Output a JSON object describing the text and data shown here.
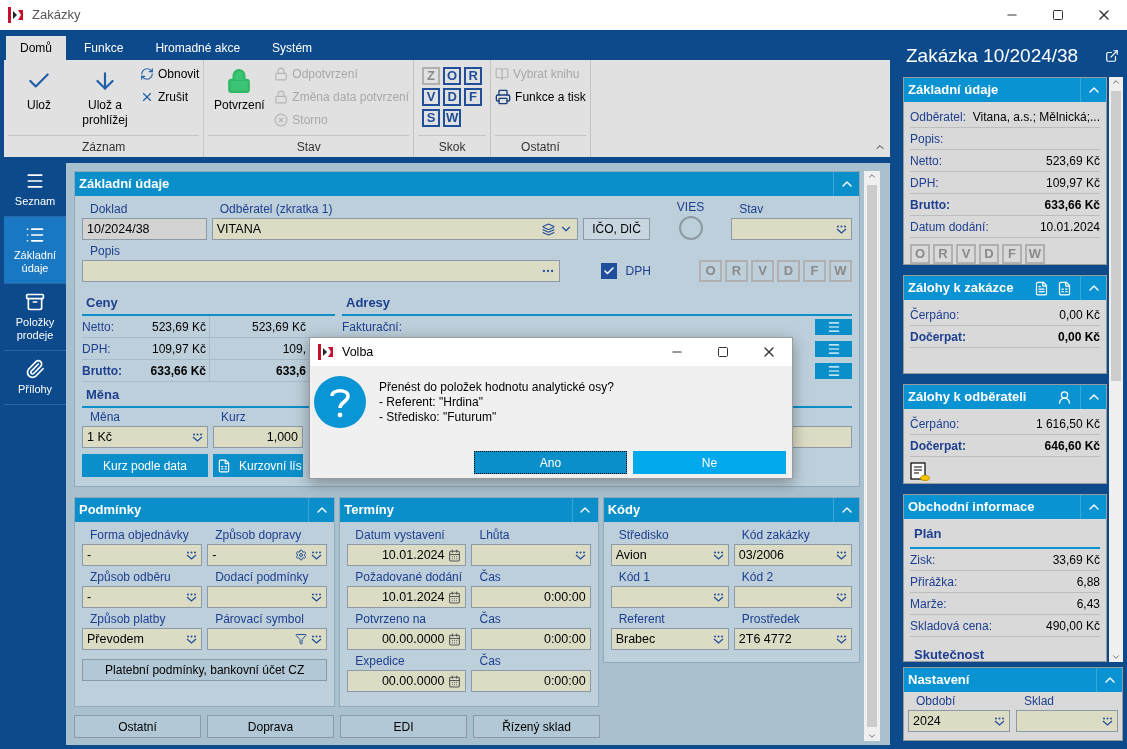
{
  "window": {
    "title": "Zakázky"
  },
  "ribbon": {
    "tabs": [
      {
        "label": "Domů",
        "selected": true
      },
      {
        "label": "Funkce",
        "selected": false
      },
      {
        "label": "Hromadné akce",
        "selected": false
      },
      {
        "label": "Systém",
        "selected": false
      }
    ],
    "groups": [
      {
        "label": "Záznam",
        "items": [
          {
            "kind": "large",
            "label": "Ulož",
            "disabled": false
          },
          {
            "kind": "large",
            "label": "Ulož a prohlížej",
            "disabled": false
          },
          {
            "kind": "small",
            "label": "Obnovit",
            "disabled": false
          },
          {
            "kind": "small",
            "label": "Zrušit",
            "disabled": false
          }
        ]
      },
      {
        "label": "Stav",
        "items": [
          {
            "kind": "large",
            "label": "Potvrzení",
            "disabled": false
          },
          {
            "kind": "small",
            "label": "Odpotvrzení",
            "disabled": true
          },
          {
            "kind": "small",
            "label": "Změna data potvrzení",
            "disabled": true
          },
          {
            "kind": "small",
            "label": "Storno",
            "disabled": true
          }
        ]
      },
      {
        "label": "Skok",
        "items": [
          {
            "kind": "letter",
            "label": "Z",
            "disabled": true
          },
          {
            "kind": "letter",
            "label": "O",
            "disabled": false
          },
          {
            "kind": "letter",
            "label": "R",
            "disabled": false
          },
          {
            "kind": "letter",
            "label": "V",
            "disabled": false
          },
          {
            "kind": "letter",
            "label": "D",
            "disabled": false
          },
          {
            "kind": "letter",
            "label": "F",
            "disabled": false
          },
          {
            "kind": "letter",
            "label": "S",
            "disabled": false
          },
          {
            "kind": "letter",
            "label": "W",
            "disabled": false
          }
        ]
      },
      {
        "label": "Ostatní",
        "items": [
          {
            "kind": "small",
            "label": "Vybrat knihu",
            "disabled": true
          },
          {
            "kind": "small",
            "label": "Funkce a tisk",
            "disabled": false
          }
        ]
      }
    ]
  },
  "nav": {
    "items": [
      {
        "label": "Seznam",
        "selected": false
      },
      {
        "label": "Základní údaje",
        "selected": true
      },
      {
        "label": "Položky prodeje",
        "selected": false
      },
      {
        "label": "Přílohy",
        "selected": false
      }
    ]
  },
  "form": {
    "basic": {
      "title": "Základní údaje",
      "doklad": {
        "label": "Doklad",
        "value": "10/2024/38",
        "kind": "readonly"
      },
      "odberatel": {
        "label": "Odběratel (zkratka 1)",
        "value": "VITANA",
        "kind": "combo"
      },
      "ico_button": "IČO, DIČ",
      "vies": {
        "label": "VIES"
      },
      "stav": {
        "label": "Stav",
        "kind": "dropdown"
      },
      "popis": {
        "label": "Popis",
        "kind": "lookup"
      },
      "dph": {
        "label": "DPH",
        "checked": true
      },
      "letters": [
        {
          "label": "O",
          "disabled": true
        },
        {
          "label": "R",
          "disabled": true
        },
        {
          "label": "V",
          "disabled": true
        },
        {
          "label": "D",
          "disabled": true
        },
        {
          "label": "F",
          "disabled": true
        },
        {
          "label": "W",
          "disabled": true
        }
      ],
      "ceny": {
        "title": "Ceny",
        "rows": [
          {
            "label": "Netto:",
            "value": "523,69 Kč",
            "value2": "523,69 Kč",
            "bold": false
          },
          {
            "label": "DPH:",
            "value": "109,97 Kč",
            "value2": "109,",
            "bold": false
          },
          {
            "label": "Brutto:",
            "value": "633,66 Kč",
            "value2": "633,6",
            "bold": true
          }
        ]
      },
      "adresy": {
        "title": "Adresy",
        "rows": [
          "Fakturační:"
        ]
      },
      "mena": {
        "title": "Měna",
        "fields": [
          {
            "label": "Měna",
            "value": "1 Kč",
            "kind": "dropdown"
          },
          {
            "label": "Kurz",
            "value": "1,000",
            "kind": "number"
          }
        ],
        "buttons": [
          "Kurz podle data",
          "Kurzovní lís"
        ]
      }
    },
    "podminky": {
      "title": "Podmínky",
      "fields": [
        {
          "label": "Forma objednávky",
          "value": "-",
          "kind": "dropdown"
        },
        {
          "label": "Způsob dopravy",
          "value": "-",
          "kind": "dropdown-gear"
        },
        {
          "label": "Způsob odběru",
          "value": "-",
          "kind": "dropdown"
        },
        {
          "label": "Dodací podmínky",
          "kind": "dropdown"
        },
        {
          "label": "Způsob platby",
          "value": "Převodem",
          "kind": "dropdown"
        },
        {
          "label": "Párovací symbol",
          "kind": "dropdown-filter"
        }
      ],
      "button": "Platební podmínky, bankovní účet CZ"
    },
    "terminy": {
      "title": "Termíny",
      "fields": [
        {
          "label": "Datum vystavení",
          "value": "10.01.2024",
          "kind": "date"
        },
        {
          "label": "Lhůta",
          "kind": "dropdown"
        },
        {
          "label": "Požadované dodání",
          "value": "10.01.2024",
          "kind": "date"
        },
        {
          "label": "Čas",
          "value": "0:00:00",
          "kind": "number"
        },
        {
          "label": "Potvrzeno na",
          "value": "00.00.0000",
          "kind": "date"
        },
        {
          "label": "Čas",
          "value": "0:00:00",
          "kind": "number"
        },
        {
          "label": "Expedice",
          "value": "00.00.0000",
          "kind": "date"
        },
        {
          "label": "Čas",
          "value": "0:00:00",
          "kind": "number"
        }
      ]
    },
    "kody": {
      "title": "Kódy",
      "fields": [
        {
          "label": "Středisko",
          "value": "Avion",
          "kind": "dropdown"
        },
        {
          "label": "Kód zakázky",
          "value": "03/2006",
          "kind": "dropdown"
        },
        {
          "label": "Kód 1",
          "kind": "dropdown"
        },
        {
          "label": "Kód 2",
          "kind": "dropdown"
        },
        {
          "label": "Referent",
          "value": "Brabec",
          "kind": "dropdown"
        },
        {
          "label": "Prostředek",
          "value": "2T6 4772",
          "kind": "dropdown"
        }
      ]
    },
    "bottom_buttons": [
      "Ostatní",
      "Doprava",
      "EDI",
      "Řízený sklad"
    ]
  },
  "side": {
    "title": "Zakázka 10/2024/38",
    "sections": [
      {
        "title": "Základní údaje",
        "rows": [
          {
            "label": "Odběratel:",
            "value": "Vitana, a.s.; Mělnická;...",
            "bold": false
          },
          {
            "label": "Popis:",
            "bold": false
          },
          {
            "label": "Netto:",
            "value": "523,69 Kč",
            "bold": false
          },
          {
            "label": "DPH:",
            "value": "109,97 Kč",
            "bold": false
          },
          {
            "label": "Brutto:",
            "value": "633,66 Kč",
            "bold": true
          },
          {
            "label": "Datum dodání:",
            "value": "10.01.2024",
            "bold": false
          }
        ],
        "letters": [
          {
            "label": "O",
            "disabled": true
          },
          {
            "label": "R",
            "disabled": true
          },
          {
            "label": "V",
            "disabled": true
          },
          {
            "label": "D",
            "disabled": true
          },
          {
            "label": "F",
            "disabled": true
          },
          {
            "label": "W",
            "disabled": true
          }
        ]
      },
      {
        "title": "Zálohy k zakázce",
        "rows": [
          {
            "label": "Čerpáno:",
            "value": "0,00 Kč",
            "bold": false
          },
          {
            "label": "Dočerpat:",
            "value": "0,00 Kč",
            "bold": true
          }
        ]
      },
      {
        "title": "Zálohy k odběrateli",
        "rows": [
          {
            "label": "Čerpáno:",
            "value": "1 616,50 Kč",
            "bold": false
          },
          {
            "label": "Dočerpat:",
            "value": "646,60 Kč",
            "bold": true
          }
        ]
      },
      {
        "title": "Obchodní informace",
        "subtitle": "Plán",
        "rows": [
          {
            "label": "Zisk:",
            "value": "33,69 Kč",
            "bold": false
          },
          {
            "label": "Přirážka:",
            "value": "6,88",
            "bold": false
          },
          {
            "label": "Marže:",
            "value": "6,43",
            "bold": false
          },
          {
            "label": "Skladová cena:",
            "value": "490,00 Kč",
            "bold": false
          }
        ],
        "subtitle2": "Skutečnost"
      }
    ],
    "settings": {
      "title": "Nastavení",
      "fields": [
        {
          "label": "Období",
          "value": "2024",
          "kind": "dropdown"
        },
        {
          "label": "Sklad",
          "kind": "dropdown"
        }
      ]
    }
  },
  "dialog": {
    "title": "Volba",
    "lines": [
      "Přenést do položek hodnotu analytické osy?",
      "- Referent: \"Hrdina\"",
      "- Středisko: \"Futurum\""
    ],
    "buttons": [
      {
        "label": "Ano",
        "focused": true
      },
      {
        "label": "Ne",
        "focused": false
      }
    ]
  }
}
